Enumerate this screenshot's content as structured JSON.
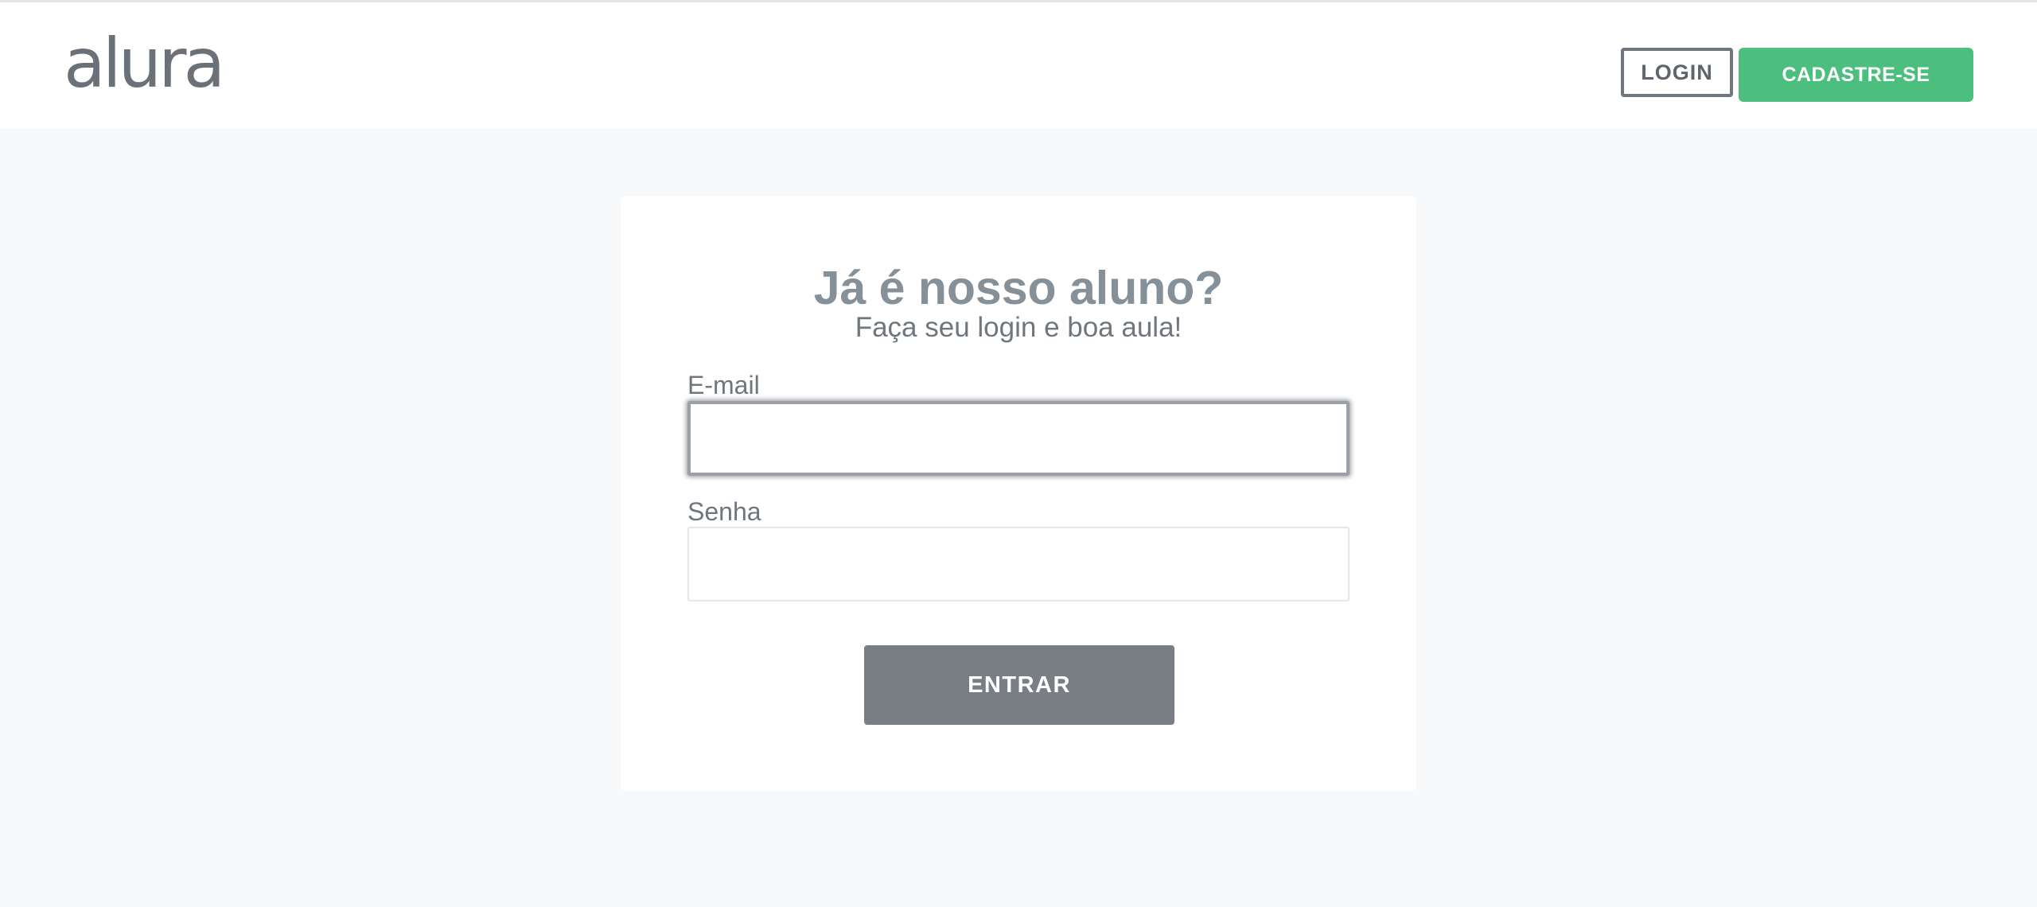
{
  "header": {
    "logo_text": "alura",
    "login_label": "LOGIN",
    "signup_label": "CADASTRE-SE"
  },
  "form": {
    "title": "Já é nosso aluno?",
    "subtitle": "Faça seu login e boa aula!",
    "email_label": "E-mail",
    "email_value": "",
    "senha_label": "Senha",
    "senha_value": "",
    "submit_label": "ENTRAR"
  },
  "colors": {
    "accent_green": "#4cbf7f",
    "button_gray": "#787e84",
    "page_background": "#f8f9fb"
  }
}
